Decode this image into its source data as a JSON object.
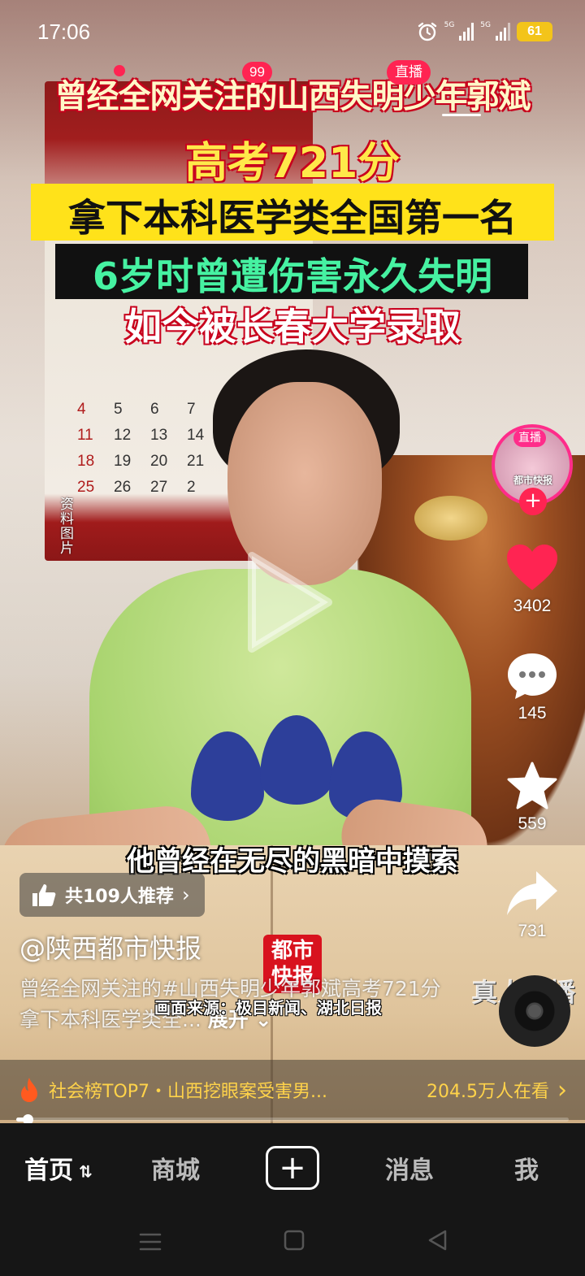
{
  "status_bar": {
    "time": "17:06",
    "battery": "61",
    "signal1": "5G",
    "signal2": "5G"
  },
  "top": {
    "badge_count": "99",
    "live_badge": "直播"
  },
  "overlay": {
    "line1": "曾经全网关注的山西失明少年郭斌",
    "line2": "高考721分",
    "line3": "拿下本科医学类全国第一名",
    "line4": "6岁时曾遭伤害永久失明",
    "line5": "如今被长春大学录取",
    "side_note": "资料图片"
  },
  "calendar": {
    "rows": [
      [
        "4",
        "5",
        "6",
        "7"
      ],
      [
        "11",
        "12",
        "13",
        "14"
      ],
      [
        "18",
        "19",
        "20",
        "21"
      ],
      [
        "25",
        "26",
        "27",
        "2"
      ]
    ]
  },
  "right_rail": {
    "live_tag": "直播",
    "live_name": "都市快报",
    "likes": "3402",
    "comments": "145",
    "favorites": "559",
    "shares": "731"
  },
  "video": {
    "subtitle": "他曾经在无尽的黑暗中摸索",
    "recommend": "共109人推荐",
    "author": "@陕西都市快报",
    "description": "曾经全网关注的#山西失明少年郭斌高考721分 拿下本科医学类全...",
    "expand": "展开",
    "source": "画面来源：极目新闻、湖北日报",
    "logo": "都市快报",
    "watermark": "真人直播"
  },
  "trend": {
    "label": "社会榜TOP7・山西挖眼案受害男...",
    "viewers": "204.5万人在看"
  },
  "progress": {
    "fraction": 0.02
  },
  "nav": {
    "home": "首页",
    "mall": "商城",
    "messages": "消息",
    "me": "我"
  }
}
